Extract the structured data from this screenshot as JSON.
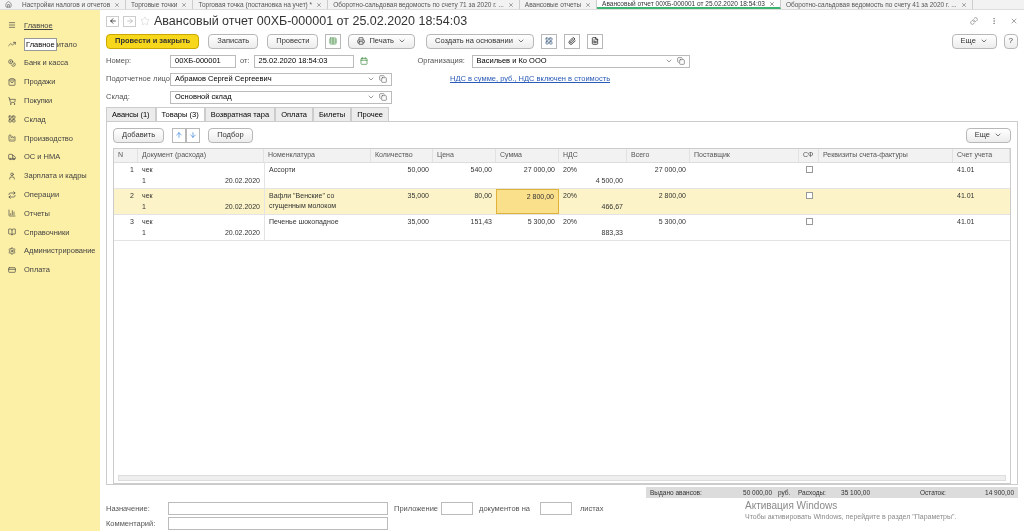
{
  "top_tabs": [
    {
      "label": "Настройки налогов и отчетов",
      "selected": false
    },
    {
      "label": "Торговые точки",
      "selected": false
    },
    {
      "label": "Торговая точка (постановка на учет) *",
      "selected": false
    },
    {
      "label": "Оборотно-сальдовая ведомость по счету 71 за 2020 г. ...",
      "selected": false
    },
    {
      "label": "Авансовые отчеты",
      "selected": false
    },
    {
      "label": "Авансовый отчет 00ХБ-000001 от 25.02.2020 18:54:03",
      "selected": true
    },
    {
      "label": "Оборотно-сальдовая ведомость по счету 41 за 2020 г. ...",
      "selected": false
    }
  ],
  "sidebar": {
    "items": [
      {
        "label": "Главное",
        "selected": false
      },
      {
        "label": "итало",
        "selected": false,
        "tooltip": "Главное"
      },
      {
        "label": "Банк и касса",
        "selected": false
      },
      {
        "label": "Продажи",
        "selected": false
      },
      {
        "label": "Покупки",
        "selected": false
      },
      {
        "label": "Склад",
        "selected": false
      },
      {
        "label": "Производство",
        "selected": false
      },
      {
        "label": "ОС и НМА",
        "selected": false
      },
      {
        "label": "Зарплата и кадры",
        "selected": false
      },
      {
        "label": "Операции",
        "selected": false
      },
      {
        "label": "Отчеты",
        "selected": false
      },
      {
        "label": "Справочники",
        "selected": false
      },
      {
        "label": "Администрирование",
        "selected": false
      },
      {
        "label": "Оплата",
        "selected": false
      }
    ]
  },
  "window": {
    "title": "Авансовый отчет 00ХБ-000001 от 25.02.2020 18:54:03"
  },
  "toolbar": {
    "primary": "Провести и закрыть",
    "save": "Записать",
    "post": "Провести",
    "print": "Печать",
    "create_based": "Создать на основании",
    "more": "Еще",
    "help": "?"
  },
  "form": {
    "number_label": "Номер:",
    "number": "00ХБ-000001",
    "date_label": "от:",
    "date": "25.02.2020 18:54:03",
    "org_label": "Организация:",
    "org": "Васильев и Ко ООО",
    "person_label": "Подотчетное лицо:",
    "person": "Абрамов Сергей Сергеевич",
    "vat_link": "НДС в сумме, руб., НДС включен в стоимость",
    "warehouse_label": "Склад:",
    "warehouse": "Основной склад"
  },
  "tabs": [
    {
      "label": "Авансы (1)",
      "selected": false
    },
    {
      "label": "Товары (3)",
      "selected": true
    },
    {
      "label": "Возвратная тара",
      "selected": false
    },
    {
      "label": "Оплата",
      "selected": false
    },
    {
      "label": "Билеты",
      "selected": false
    },
    {
      "label": "Прочее",
      "selected": false
    }
  ],
  "table_toolbar": {
    "add": "Добавить",
    "pick": "Подбор",
    "more": "Еще"
  },
  "table": {
    "columns": [
      "N",
      "Документ (расхода)",
      "Номенклатура",
      "Количество",
      "Цена",
      "Сумма",
      "НДС",
      "Всего",
      "Поставщик",
      "СФ",
      "Реквизиты счета-фактуры",
      "Счет учета"
    ],
    "rows": [
      {
        "n": "1",
        "doc": "чек",
        "doc_no": "1",
        "doc_date": "20.02.2020",
        "item": "Ассорти",
        "qty": "50,000",
        "price": "540,00",
        "sum": "27 000,00",
        "vat_rate": "20%",
        "vat": "4 500,00",
        "total": "27 000,00",
        "invoice": false,
        "account": "41.01",
        "selected": false
      },
      {
        "n": "2",
        "doc": "чек",
        "doc_no": "1",
        "doc_date": "20.02.2020",
        "item": "Вафли \"Венские\" со сгущенным молоком",
        "qty": "35,000",
        "price": "80,00",
        "sum": "2 800,00",
        "vat_rate": "20%",
        "vat": "466,67",
        "total": "2 800,00",
        "invoice": false,
        "account": "41.01",
        "selected": true
      },
      {
        "n": "3",
        "doc": "чек",
        "doc_no": "1",
        "doc_date": "20.02.2020",
        "item": "Печенье шокопадное",
        "qty": "35,000",
        "price": "151,43",
        "sum": "5 300,00",
        "vat_rate": "20%",
        "vat": "883,33",
        "total": "5 300,00",
        "invoice": false,
        "account": "41.01",
        "selected": false
      }
    ]
  },
  "totals": {
    "issued_label": "Выдано авансов:",
    "issued": "50 000,00",
    "currency": "руб.",
    "expenses_label": "Расходы:",
    "expenses": "35 100,00",
    "rest_label": "Остаток:",
    "rest": "14 900,00"
  },
  "footer": {
    "purpose_label": "Назначение:",
    "attach_label": "Приложение",
    "docs_label": "документов на",
    "sheets_label": "листах",
    "comment_label": "Комментарий:"
  },
  "activation": {
    "title": "Активация Windows",
    "text": "Чтобы активировать Windows, перейдите в раздел \"Параметры\"."
  }
}
